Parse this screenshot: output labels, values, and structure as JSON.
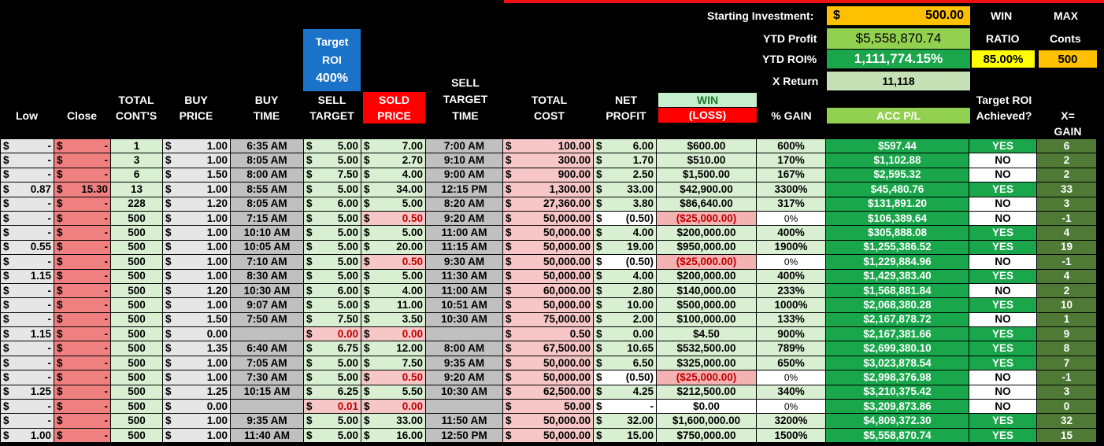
{
  "summary": {
    "starting_investment_label": "Starting Investment:",
    "starting_investment_currency": "$",
    "starting_investment_value": "500.00",
    "ytd_profit_label": "YTD Profit",
    "ytd_profit_value": "$5,558,870.74",
    "ytd_roi_label": "YTD ROI%",
    "ytd_roi_value": "1,111,774.15%",
    "x_return_label": "X Return",
    "x_return_value": "11,118",
    "win_label": "WIN",
    "ratio_label": "RATIO",
    "win_ratio_value": "85.00%",
    "max_label": "MAX",
    "conts_label": "Conts",
    "max_conts_value": "500"
  },
  "target_roi": {
    "line1": "Target",
    "line2": "ROI",
    "value": "400%"
  },
  "headers": {
    "low": "Low",
    "close": "Close",
    "total_conts_1": "TOTAL",
    "total_conts_2": "CONT'S",
    "buy_price_1": "BUY",
    "buy_price_2": "PRICE",
    "buy_time_1": "BUY",
    "buy_time_2": "TIME",
    "sell_target_1": "SELL",
    "sell_target_2": "TARGET",
    "sold_price_1": "SOLD",
    "sold_price_2": "PRICE",
    "sell_target_time_1": "SELL",
    "sell_target_time_2": "TARGET",
    "sell_target_time_3": "TIME",
    "total_cost_1": "TOTAL",
    "total_cost_2": "COST",
    "net_profit_1": "NET",
    "net_profit_2": "PROFIT",
    "win_1": "WIN",
    "win_2": "(LOSS)",
    "pct_gain": "% GAIN",
    "acc_pl": "ACC P/L",
    "target_achieved_1": "Target ROI",
    "target_achieved_2": "Achieved?",
    "xgain_1": "X=",
    "xgain_2": "GAIN"
  },
  "rows": [
    {
      "low": "-",
      "close": "-",
      "conts": "1",
      "buy": "1.00",
      "btime": "6:35 AM",
      "sell": "5.00",
      "sold": "7.00",
      "stime": "7:00 AM",
      "cost": "100.00",
      "net": "6.00",
      "win": "$600.00",
      "pct": "600%",
      "acc": "$597.44",
      "ach": "YES",
      "x": "6",
      "loss": false
    },
    {
      "low": "-",
      "close": "-",
      "conts": "3",
      "buy": "1.00",
      "btime": "8:05 AM",
      "sell": "5.00",
      "sold": "2.70",
      "stime": "9:10 AM",
      "cost": "300.00",
      "net": "1.70",
      "win": "$510.00",
      "pct": "170%",
      "acc": "$1,102.88",
      "ach": "NO",
      "x": "2",
      "loss": false
    },
    {
      "low": "-",
      "close": "-",
      "conts": "6",
      "buy": "1.50",
      "btime": "8:00 AM",
      "sell": "7.50",
      "sold": "4.00",
      "stime": "9:00 AM",
      "cost": "900.00",
      "net": "2.50",
      "win": "$1,500.00",
      "pct": "167%",
      "acc": "$2,595.32",
      "ach": "NO",
      "x": "2",
      "loss": false
    },
    {
      "low": "0.87",
      "close": "15.30",
      "conts": "13",
      "buy": "1.00",
      "btime": "8:55 AM",
      "sell": "5.00",
      "sold": "34.00",
      "stime": "12:15 PM",
      "cost": "1,300.00",
      "net": "33.00",
      "win": "$42,900.00",
      "pct": "3300%",
      "acc": "$45,480.76",
      "ach": "YES",
      "x": "33",
      "loss": false
    },
    {
      "low": "-",
      "close": "-",
      "conts": "228",
      "buy": "1.20",
      "btime": "8:05 AM",
      "sell": "6.00",
      "sold": "5.00",
      "stime": "8:20 AM",
      "cost": "27,360.00",
      "net": "3.80",
      "win": "$86,640.00",
      "pct": "317%",
      "acc": "$131,891.20",
      "ach": "NO",
      "x": "3",
      "loss": false
    },
    {
      "low": "-",
      "close": "-",
      "conts": "500",
      "buy": "1.00",
      "btime": "7:15 AM",
      "sell": "5.00",
      "sold": "0.50",
      "stime": "9:20 AM",
      "cost": "50,000.00",
      "net": "(0.50)",
      "win": "($25,000.00)",
      "pct": "0%",
      "acc": "$106,389.64",
      "ach": "NO",
      "x": "-1",
      "loss": true
    },
    {
      "low": "-",
      "close": "-",
      "conts": "500",
      "buy": "1.00",
      "btime": "10:10 AM",
      "sell": "5.00",
      "sold": "5.00",
      "stime": "11:00 AM",
      "cost": "50,000.00",
      "net": "4.00",
      "win": "$200,000.00",
      "pct": "400%",
      "acc": "$305,888.08",
      "ach": "YES",
      "x": "4",
      "loss": false
    },
    {
      "low": "0.55",
      "close": "-",
      "conts": "500",
      "buy": "1.00",
      "btime": "10:05 AM",
      "sell": "5.00",
      "sold": "20.00",
      "stime": "11:15 AM",
      "cost": "50,000.00",
      "net": "19.00",
      "win": "$950,000.00",
      "pct": "1900%",
      "acc": "$1,255,386.52",
      "ach": "YES",
      "x": "19",
      "loss": false
    },
    {
      "low": "-",
      "close": "-",
      "conts": "500",
      "buy": "1.00",
      "btime": "7:10 AM",
      "sell": "5.00",
      "sold": "0.50",
      "stime": "9:30 AM",
      "cost": "50,000.00",
      "net": "(0.50)",
      "win": "($25,000.00)",
      "pct": "0%",
      "acc": "$1,229,884.96",
      "ach": "NO",
      "x": "-1",
      "loss": true
    },
    {
      "low": "1.15",
      "close": "-",
      "conts": "500",
      "buy": "1.00",
      "btime": "8:30 AM",
      "sell": "5.00",
      "sold": "5.00",
      "stime": "11:30 AM",
      "cost": "50,000.00",
      "net": "4.00",
      "win": "$200,000.00",
      "pct": "400%",
      "acc": "$1,429,383.40",
      "ach": "YES",
      "x": "4",
      "loss": false
    },
    {
      "low": "-",
      "close": "-",
      "conts": "500",
      "buy": "1.20",
      "btime": "10:30 AM",
      "sell": "6.00",
      "sold": "4.00",
      "stime": "11:00 AM",
      "cost": "60,000.00",
      "net": "2.80",
      "win": "$140,000.00",
      "pct": "233%",
      "acc": "$1,568,881.84",
      "ach": "NO",
      "x": "2",
      "loss": false
    },
    {
      "low": "-",
      "close": "-",
      "conts": "500",
      "buy": "1.00",
      "btime": "9:07 AM",
      "sell": "5.00",
      "sold": "11.00",
      "stime": "10:51 AM",
      "cost": "50,000.00",
      "net": "10.00",
      "win": "$500,000.00",
      "pct": "1000%",
      "acc": "$2,068,380.28",
      "ach": "YES",
      "x": "10",
      "loss": false
    },
    {
      "low": "-",
      "close": "-",
      "conts": "500",
      "buy": "1.50",
      "btime": "7:50 AM",
      "sell": "7.50",
      "sold": "3.50",
      "stime": "10:30 AM",
      "cost": "75,000.00",
      "net": "2.00",
      "win": "$100,000.00",
      "pct": "133%",
      "acc": "$2,167,878.72",
      "ach": "NO",
      "x": "1",
      "loss": false
    },
    {
      "low": "1.15",
      "close": "-",
      "conts": "500",
      "buy": "0.00",
      "btime": "",
      "sell": "0.00",
      "sold": "0.00",
      "stime": "",
      "cost": "0.50",
      "net": "0.00",
      "win": "$4.50",
      "pct": "900%",
      "acc": "$2,167,381.66",
      "ach": "YES",
      "x": "9",
      "loss": false,
      "sellred": true
    },
    {
      "low": "-",
      "close": "-",
      "conts": "500",
      "buy": "1.35",
      "btime": "6:40 AM",
      "sell": "6.75",
      "sold": "12.00",
      "stime": "8:00 AM",
      "cost": "67,500.00",
      "net": "10.65",
      "win": "$532,500.00",
      "pct": "789%",
      "acc": "$2,699,380.10",
      "ach": "YES",
      "x": "8",
      "loss": false
    },
    {
      "low": "-",
      "close": "-",
      "conts": "500",
      "buy": "1.00",
      "btime": "7:05 AM",
      "sell": "5.00",
      "sold": "7.50",
      "stime": "9:35 AM",
      "cost": "50,000.00",
      "net": "6.50",
      "win": "$325,000.00",
      "pct": "650%",
      "acc": "$3,023,878.54",
      "ach": "YES",
      "x": "7",
      "loss": false
    },
    {
      "low": "-",
      "close": "-",
      "conts": "500",
      "buy": "1.00",
      "btime": "7:30 AM",
      "sell": "5.00",
      "sold": "0.50",
      "stime": "9:20 AM",
      "cost": "50,000.00",
      "net": "(0.50)",
      "win": "($25,000.00)",
      "pct": "0%",
      "acc": "$2,998,376.98",
      "ach": "NO",
      "x": "-1",
      "loss": true
    },
    {
      "low": "1.25",
      "close": "-",
      "conts": "500",
      "buy": "1.25",
      "btime": "10:15 AM",
      "sell": "6.25",
      "sold": "5.50",
      "stime": "10:30 AM",
      "cost": "62,500.00",
      "net": "4.25",
      "win": "$212,500.00",
      "pct": "340%",
      "acc": "$3,210,375.42",
      "ach": "NO",
      "x": "3",
      "loss": false
    },
    {
      "low": "-",
      "close": "-",
      "conts": "500",
      "buy": "0.00",
      "btime": "",
      "sell": "0.01",
      "sold": "0.00",
      "stime": "",
      "cost": "50.00",
      "net": "-",
      "win": "$0.00",
      "pct": "0%",
      "acc": "$3,209,873.86",
      "ach": "NO",
      "x": "0",
      "loss": false,
      "zero": true,
      "sellred": true
    },
    {
      "low": "-",
      "close": "-",
      "conts": "500",
      "buy": "1.00",
      "btime": "9:35 AM",
      "sell": "5.00",
      "sold": "33.00",
      "stime": "11:50 AM",
      "cost": "50,000.00",
      "net": "32.00",
      "win": "$1,600,000.00",
      "pct": "3200%",
      "acc": "$4,809,372.30",
      "ach": "YES",
      "x": "32",
      "loss": false
    },
    {
      "low": "1.00",
      "close": "-",
      "conts": "500",
      "buy": "1.00",
      "btime": "11:40 AM",
      "sell": "5.00",
      "sold": "16.00",
      "stime": "12:50 PM",
      "cost": "50,000.00",
      "net": "15.00",
      "win": "$750,000.00",
      "pct": "1500%",
      "acc": "$5,558,870.74",
      "ach": "YES",
      "x": "15",
      "loss": false
    }
  ],
  "currency_symbol": "$",
  "colors": {
    "green_dark": "#1aa64b",
    "olive": "#4f7a35",
    "light_green": "#d8efd2",
    "pink": "#f4b3b3",
    "salmon": "#f08080",
    "gold": "#ffc000",
    "yellow": "#ffff00",
    "blue": "#1a73c9",
    "red": "#ff0000"
  }
}
